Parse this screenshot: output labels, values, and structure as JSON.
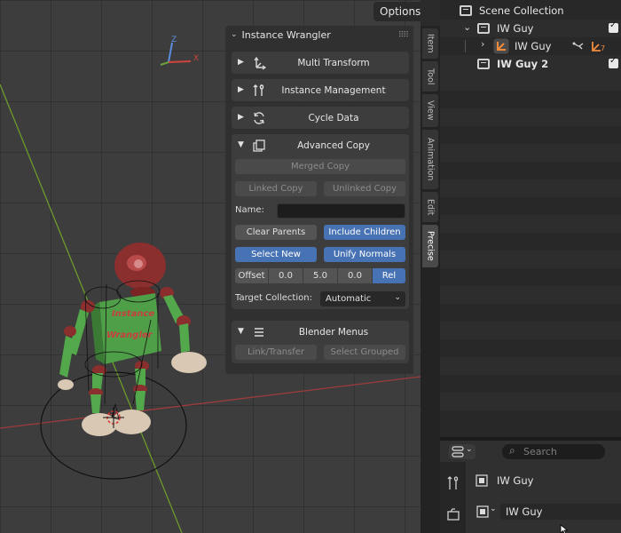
{
  "viewport": {
    "options_label": "Options",
    "mesh_text_top": "Instance",
    "mesh_text_bottom": "Wrangler",
    "gizmo": {
      "z": "Z",
      "x": "X"
    },
    "colors": {
      "body": "#52a84a",
      "head": "#8a2e2e",
      "feet": "#d8c8b4"
    }
  },
  "panel": {
    "title": "Instance Wrangler",
    "collapsed_sections": [
      {
        "label": "Multi Transform",
        "icon": "transform-axes-icon"
      },
      {
        "label": "Instance Management",
        "icon": "tools-icon"
      },
      {
        "label": "Cycle Data",
        "icon": "cycle-icon"
      }
    ],
    "advanced_copy": {
      "label": "Advanced Copy",
      "merged_copy": "Merged Copy",
      "linked_copy": "Linked Copy",
      "unlinked_copy": "Unlinked Copy",
      "name_label": "Name:",
      "name_value": "",
      "clear_parents": "Clear Parents",
      "include_children": "Include Children",
      "select_new": "Select New",
      "unify_normals": "Unify Normals",
      "offset_label": "Offset",
      "offset_values": [
        "0.0",
        "5.0",
        "0.0"
      ],
      "rel_label": "Rel",
      "target_collection_label": "Target Collection:",
      "target_collection_value": "Automatic"
    },
    "blender_menus": {
      "label": "Blender Menus",
      "link_transfer": "Link/Transfer",
      "select_grouped": "Select Grouped"
    }
  },
  "tabs": [
    "Item",
    "Tool",
    "View",
    "Animation",
    "Edit",
    "Precise"
  ],
  "active_tab": "Precise",
  "outliner": {
    "root": "Scene Collection",
    "rows": [
      {
        "label": "IW Guy",
        "type": "collection"
      },
      {
        "label": "IW Guy",
        "type": "armature",
        "modifier_count": "7"
      },
      {
        "label": "IW Guy 2",
        "type": "collection"
      }
    ]
  },
  "properties": {
    "search_placeholder": "Search",
    "object_name": "IW Guy",
    "data_name": "IW Guy"
  },
  "accent": "#4772b3"
}
